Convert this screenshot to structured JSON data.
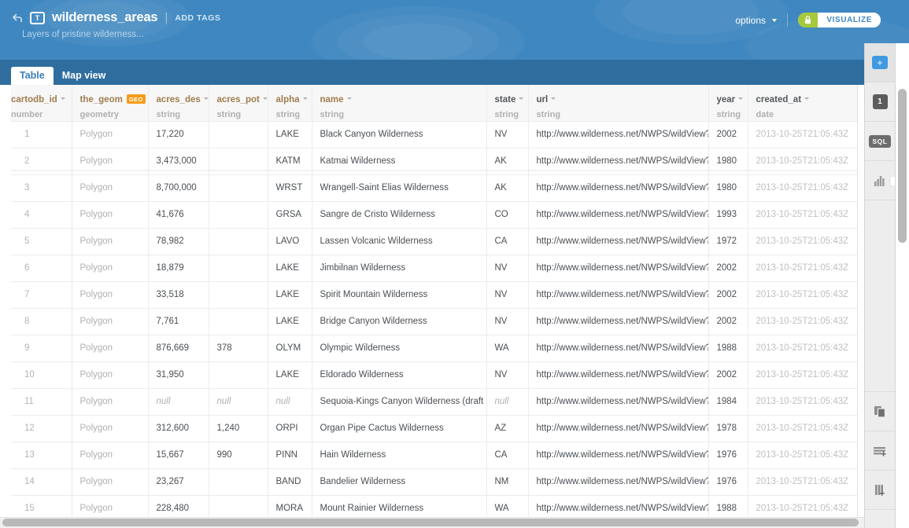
{
  "header": {
    "back_icon": "back-arrow-icon",
    "type_badge": "T",
    "title": "wilderness_areas",
    "separator": "|",
    "add_tags_label": "ADD TAGS",
    "description": "Layers of pristine wilderness...",
    "options_label": "options",
    "lock_icon": "lock-icon",
    "visualize_label": "VISUALIZE",
    "accent_blue": "#3f87c0",
    "accent_green": "#a6c93c"
  },
  "tabs": [
    {
      "label": "Table",
      "active": true
    },
    {
      "label": "Map view",
      "active": false
    }
  ],
  "table": {
    "columns": [
      {
        "name": "cartodb_id",
        "type": "number",
        "style": "orange",
        "badge": null
      },
      {
        "name": "the_geom",
        "type": "geometry",
        "style": "orange",
        "badge": "GEO"
      },
      {
        "name": "acres_des",
        "type": "string",
        "style": "orange",
        "badge": null
      },
      {
        "name": "acres_pot",
        "type": "string",
        "style": "orange",
        "badge": null
      },
      {
        "name": "alpha",
        "type": "string",
        "style": "orange",
        "badge": null
      },
      {
        "name": "name",
        "type": "string",
        "style": "orange",
        "badge": null
      },
      {
        "name": "state",
        "type": "string",
        "style": "dark",
        "badge": null
      },
      {
        "name": "url",
        "type": "string",
        "style": "dark",
        "badge": null
      },
      {
        "name": "year",
        "type": "string",
        "style": "dark",
        "badge": null
      },
      {
        "name": "created_at",
        "type": "date",
        "style": "dark",
        "badge": null
      }
    ],
    "url_value": "http://www.wilderness.net/NWPS/wildView?...",
    "created_at_value": "2013-10-25T21:05:43Z",
    "geom_value": "Polygon",
    "null_value": "null",
    "rows": [
      {
        "cartodb_id": "1",
        "the_geom": "Polygon",
        "acres_des": "17,220",
        "acres_pot": "",
        "alpha": "LAKE",
        "name": "Black Canyon Wilderness",
        "state": "NV",
        "url": "http://www.wilderness.net/NWPS/wildView?...",
        "year": "2002",
        "created_at": "2013-10-25T21:05:43Z"
      },
      {
        "cartodb_id": "2",
        "the_geom": "Polygon",
        "acres_des": "3,473,000",
        "acres_pot": "",
        "alpha": "KATM",
        "name": "Katmai Wilderness",
        "state": "AK",
        "url": "http://www.wilderness.net/NWPS/wildView?...",
        "year": "1980",
        "created_at": "2013-10-25T21:05:43Z"
      },
      {
        "cartodb_id": "3",
        "the_geom": "Polygon",
        "acres_des": "8,700,000",
        "acres_pot": "",
        "alpha": "WRST",
        "name": "Wrangell-Saint Elias Wilderness",
        "state": "AK",
        "url": "http://www.wilderness.net/NWPS/wildView?...",
        "year": "1980",
        "created_at": "2013-10-25T21:05:43Z"
      },
      {
        "cartodb_id": "4",
        "the_geom": "Polygon",
        "acres_des": "41,676",
        "acres_pot": "",
        "alpha": "GRSA",
        "name": "Sangre de Cristo Wilderness",
        "state": "CO",
        "url": "http://www.wilderness.net/NWPS/wildView?...",
        "year": "1993",
        "created_at": "2013-10-25T21:05:43Z"
      },
      {
        "cartodb_id": "5",
        "the_geom": "Polygon",
        "acres_des": "78,982",
        "acres_pot": "",
        "alpha": "LAVO",
        "name": "Lassen Volcanic Wilderness",
        "state": "CA",
        "url": "http://www.wilderness.net/NWPS/wildView?...",
        "year": "1972",
        "created_at": "2013-10-25T21:05:43Z"
      },
      {
        "cartodb_id": "6",
        "the_geom": "Polygon",
        "acres_des": "18,879",
        "acres_pot": "",
        "alpha": "LAKE",
        "name": "Jimbilnan Wilderness",
        "state": "NV",
        "url": "http://www.wilderness.net/NWPS/wildView?...",
        "year": "2002",
        "created_at": "2013-10-25T21:05:43Z"
      },
      {
        "cartodb_id": "7",
        "the_geom": "Polygon",
        "acres_des": "33,518",
        "acres_pot": "",
        "alpha": "LAKE",
        "name": "Spirit Mountain Wilderness",
        "state": "NV",
        "url": "http://www.wilderness.net/NWPS/wildView?...",
        "year": "2002",
        "created_at": "2013-10-25T21:05:43Z"
      },
      {
        "cartodb_id": "8",
        "the_geom": "Polygon",
        "acres_des": "7,761",
        "acres_pot": "",
        "alpha": "LAKE",
        "name": "Bridge Canyon Wilderness",
        "state": "NV",
        "url": "http://www.wilderness.net/NWPS/wildView?...",
        "year": "2002",
        "created_at": "2013-10-25T21:05:43Z"
      },
      {
        "cartodb_id": "9",
        "the_geom": "Polygon",
        "acres_des": "876,669",
        "acres_pot": "378",
        "alpha": "OLYM",
        "name": "Olympic Wilderness",
        "state": "WA",
        "url": "http://www.wilderness.net/NWPS/wildView?...",
        "year": "1988",
        "created_at": "2013-10-25T21:05:43Z"
      },
      {
        "cartodb_id": "10",
        "the_geom": "Polygon",
        "acres_des": "31,950",
        "acres_pot": "",
        "alpha": "LAKE",
        "name": "Eldorado Wilderness",
        "state": "NV",
        "url": "http://www.wilderness.net/NWPS/wildView?...",
        "year": "2002",
        "created_at": "2013-10-25T21:05:43Z"
      },
      {
        "cartodb_id": "11",
        "the_geom": "Polygon",
        "acres_des": "null",
        "acres_pot": "null",
        "alpha": "null",
        "name": "Sequoia-Kings Canyon Wilderness (draft bo...",
        "state": "null",
        "url": "http://www.wilderness.net/NWPS/wildView?...",
        "year": "1984",
        "created_at": "2013-10-25T21:05:43Z"
      },
      {
        "cartodb_id": "12",
        "the_geom": "Polygon",
        "acres_des": "312,600",
        "acres_pot": "1,240",
        "alpha": "ORPI",
        "name": "Organ Pipe Cactus Wilderness",
        "state": "AZ",
        "url": "http://www.wilderness.net/NWPS/wildView?...",
        "year": "1978",
        "created_at": "2013-10-25T21:05:43Z"
      },
      {
        "cartodb_id": "13",
        "the_geom": "Polygon",
        "acres_des": "15,667",
        "acres_pot": "990",
        "alpha": "PINN",
        "name": "Hain Wilderness",
        "state": "CA",
        "url": "http://www.wilderness.net/NWPS/wildView?...",
        "year": "1976",
        "created_at": "2013-10-25T21:05:43Z"
      },
      {
        "cartodb_id": "14",
        "the_geom": "Polygon",
        "acres_des": "23,267",
        "acres_pot": "",
        "alpha": "BAND",
        "name": "Bandelier Wilderness",
        "state": "NM",
        "url": "http://www.wilderness.net/NWPS/wildView?...",
        "year": "1976",
        "created_at": "2013-10-25T21:05:43Z"
      },
      {
        "cartodb_id": "15",
        "the_geom": "Polygon",
        "acres_des": "228,480",
        "acres_pot": "",
        "alpha": "MORA",
        "name": "Mount Rainier Wilderness",
        "state": "WA",
        "url": "http://www.wilderness.net/NWPS/wildView?...",
        "year": "1988",
        "created_at": "2013-10-25T21:05:43Z"
      }
    ]
  },
  "rail": {
    "add_layer_label": "+",
    "layer_count": "1",
    "sql_label": "SQL",
    "items": [
      {
        "icon": "add-layer-icon",
        "label": "+"
      },
      {
        "icon": "layer-count-icon",
        "label": "1"
      },
      {
        "icon": "sql-icon",
        "label": "SQL"
      },
      {
        "icon": "bar-chart-icon",
        "label": ""
      },
      {
        "icon": "duplicate-icon",
        "label": ""
      },
      {
        "icon": "add-row-icon",
        "label": ""
      },
      {
        "icon": "add-column-icon",
        "label": ""
      }
    ]
  }
}
